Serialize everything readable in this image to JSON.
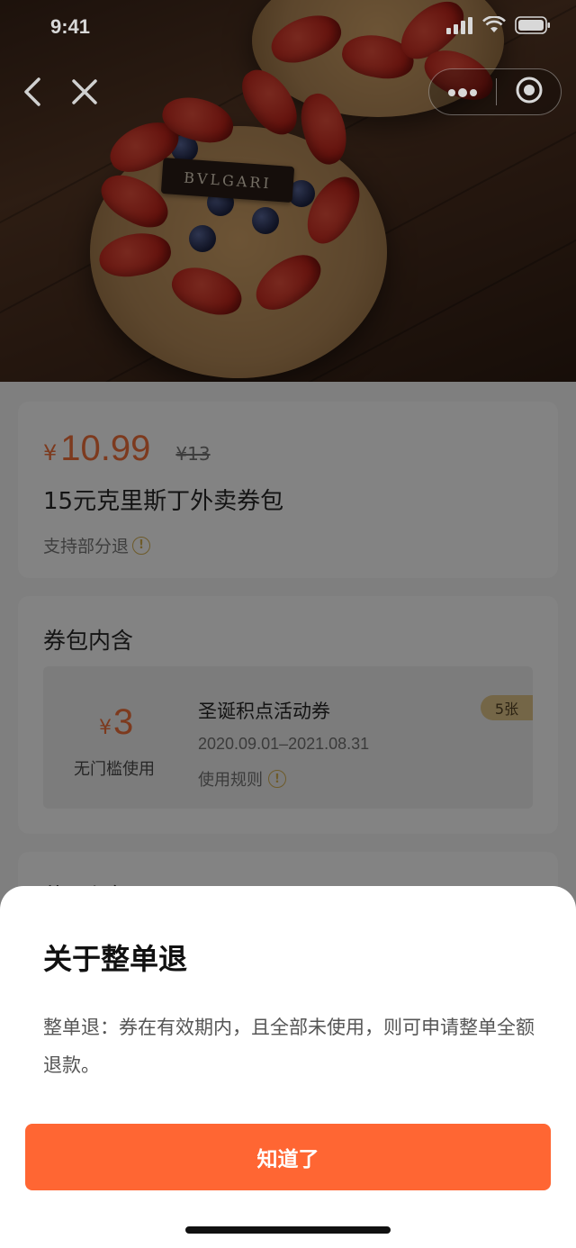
{
  "status_bar": {
    "time": "9:41",
    "icons": [
      "signal-icon",
      "wifi-icon",
      "battery-icon"
    ]
  },
  "nav": {
    "icons": [
      "back-icon",
      "close-icon",
      "more-icon",
      "target-icon"
    ]
  },
  "hero": {
    "brand_tag": "BVLGARI"
  },
  "product": {
    "currency": "¥",
    "price": "10.99",
    "original_price": "¥13",
    "title": "15元克里斯丁外卖券包",
    "refund_hint": "支持部分退"
  },
  "pack": {
    "title": "券包内含",
    "voucher": {
      "currency": "¥",
      "amount": "3",
      "condition": "无门槛使用",
      "name": "圣诞积点活动券",
      "validity": "2020.09.01–2021.08.31",
      "rule_link": "使用规则",
      "count": "5张"
    }
  },
  "third_card": {
    "title": "使用须知"
  },
  "sheet": {
    "title": "关于整单退",
    "body": "整单退：券在有效期内，且全部未使用，则可申请整单全额退款。",
    "button": "知道了"
  },
  "colors": {
    "accent": "#ff6633",
    "price": "#e4572e",
    "badge": "#e8cc8f"
  }
}
